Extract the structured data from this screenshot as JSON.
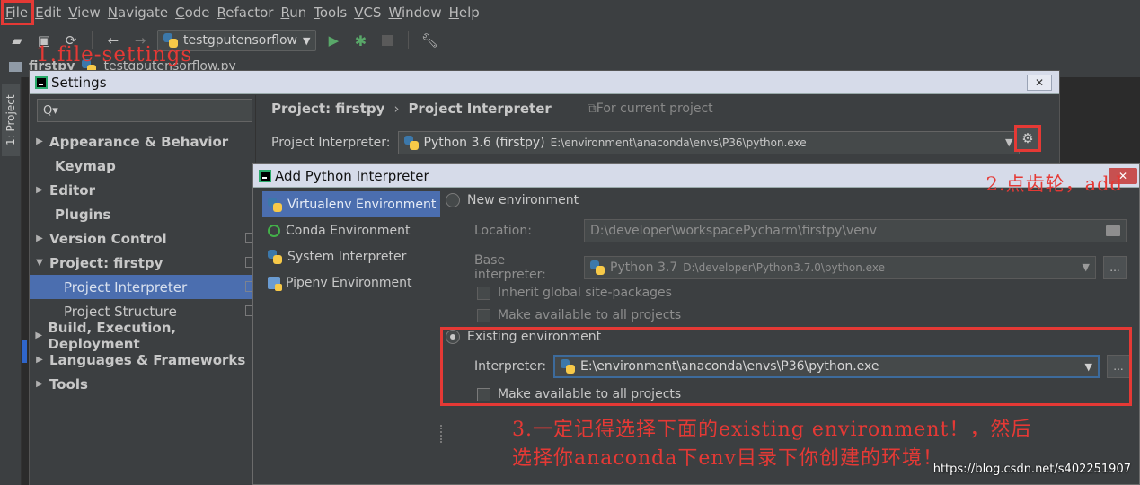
{
  "menubar": {
    "items": [
      "File",
      "Edit",
      "View",
      "Navigate",
      "Code",
      "Refactor",
      "Run",
      "Tools",
      "VCS",
      "Window",
      "Help"
    ]
  },
  "toolbar": {
    "run_config": "testgputensorflow",
    "icons": [
      "folder-open-icon",
      "save-icon",
      "sync-icon",
      "back-arrow-icon",
      "forward-arrow-icon",
      "run-icon",
      "debug-icon",
      "stop-icon",
      "wrench-icon"
    ]
  },
  "annotations": {
    "step1": "1.file-settings",
    "step2": "2.点齿轮，add",
    "step3_line1": "3.一定记得选择下面的existing environment！，然后",
    "step3_line2": "选择你anaconda下env目录下你创建的环境！",
    "watermark": "https://blog.csdn.net/s402251907"
  },
  "navbar": {
    "project": "firstpy",
    "file": "testgputensorflow.py"
  },
  "leftstrip": {
    "tab": "1: Project"
  },
  "settings": {
    "title": "Settings",
    "tree": [
      {
        "label": "Appearance & Behavior",
        "arrow": "▶",
        "kind": "top"
      },
      {
        "label": "Keymap",
        "arrow": "",
        "kind": "noarrow"
      },
      {
        "label": "Editor",
        "arrow": "▶",
        "kind": "top"
      },
      {
        "label": "Plugins",
        "arrow": "",
        "kind": "noarrow"
      },
      {
        "label": "Version Control",
        "arrow": "▶",
        "kind": "top"
      },
      {
        "label": "Project: firstpy",
        "arrow": "▼",
        "kind": "top"
      },
      {
        "label": "Project Interpreter",
        "arrow": "",
        "kind": "sub"
      },
      {
        "label": "Project Structure",
        "arrow": "",
        "kind": "sub"
      },
      {
        "label": "Build, Execution, Deployment",
        "arrow": "▶",
        "kind": "top"
      },
      {
        "label": "Languages & Frameworks",
        "arrow": "▶",
        "kind": "top"
      },
      {
        "label": "Tools",
        "arrow": "▶",
        "kind": "top"
      }
    ],
    "crumb1": "Project: firstpy",
    "crumb_sep": "›",
    "crumb2": "Project Interpreter",
    "crumb_hint": "For current project",
    "interpreter_label": "Project Interpreter:",
    "interpreter_name": "Python 3.6 (firstpy)",
    "interpreter_path": "E:\\environment\\anaconda\\envs\\P36\\python.exe"
  },
  "dialog": {
    "title": "Add Python Interpreter",
    "env_types": [
      {
        "label": "Virtualenv Environment",
        "icon": "python-icon"
      },
      {
        "label": "Conda Environment",
        "icon": "conda-icon"
      },
      {
        "label": "System Interpreter",
        "icon": "python-icon"
      },
      {
        "label": "Pipenv Environment",
        "icon": "pipenv-icon"
      }
    ],
    "new_env_label": "New environment",
    "location_label": "Location:",
    "location_value": "D:\\developer\\workspacePycharm\\firstpy\\venv",
    "base_label": "Base interpreter:",
    "base_name": "Python 3.7",
    "base_path": "D:\\developer\\Python3.7.0\\python.exe",
    "inherit_label": "Inherit global site-packages",
    "make_available_label": "Make available to all projects",
    "existing_env_label": "Existing environment",
    "interpreter_label": "Interpreter:",
    "interpreter_value": "E:\\environment\\anaconda\\envs\\P36\\python.exe",
    "make_available_label2": "Make available to all projects",
    "dots": "..."
  }
}
